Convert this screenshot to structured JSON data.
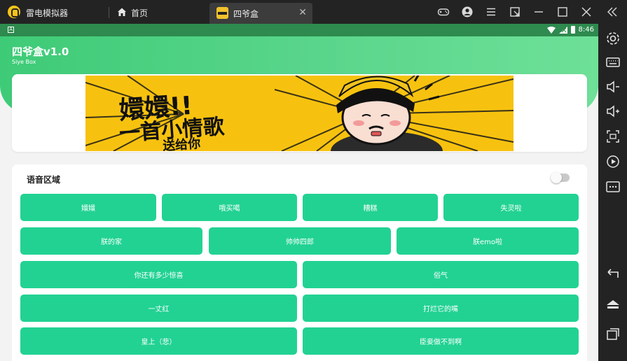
{
  "window": {
    "app_name": "雷电模拟器",
    "tabs": [
      {
        "label": "首页"
      },
      {
        "label": "四爷盒"
      }
    ],
    "close_tab_glyph": "✕"
  },
  "statusbar": {
    "notification_glyph": "A",
    "time": "8:46"
  },
  "app": {
    "title": "四爷盒v1.0",
    "subtitle": "Siye Box",
    "accent": "#22d293",
    "header_gradient": [
      "#3ecb77",
      "#6ee098"
    ]
  },
  "banner": {
    "line1": "嬛嬛!!",
    "line2": "一首小情歌",
    "line3": "送给你",
    "background": "#f7c20f"
  },
  "voice_section": {
    "title": "语音区域",
    "toggle_on": false,
    "rows": [
      [
        "嬛嬛",
        "哦买噶",
        "糟糕",
        "失灵啦"
      ],
      [
        "朕的家",
        "帅帅四郎",
        "朕emo啦"
      ],
      [
        "你还有多少惊喜",
        "俗气"
      ],
      [
        "一丈红",
        "打烂它的嘴"
      ],
      [
        "皇上（悲）",
        "臣妾做不到啊"
      ]
    ]
  },
  "toolbar_icons": [
    "gamepad-icon",
    "user-icon",
    "menu-icon",
    "popout-icon",
    "minimize-icon",
    "maximize-icon",
    "close-icon",
    "collapse-icon"
  ],
  "sidebar_icons": [
    "settings-icon",
    "keyboard-icon",
    "volume-down-icon",
    "volume-up-icon",
    "screen-resize-icon",
    "replay-icon",
    "more-icon",
    "back-icon",
    "home-icon",
    "recents-icon"
  ]
}
